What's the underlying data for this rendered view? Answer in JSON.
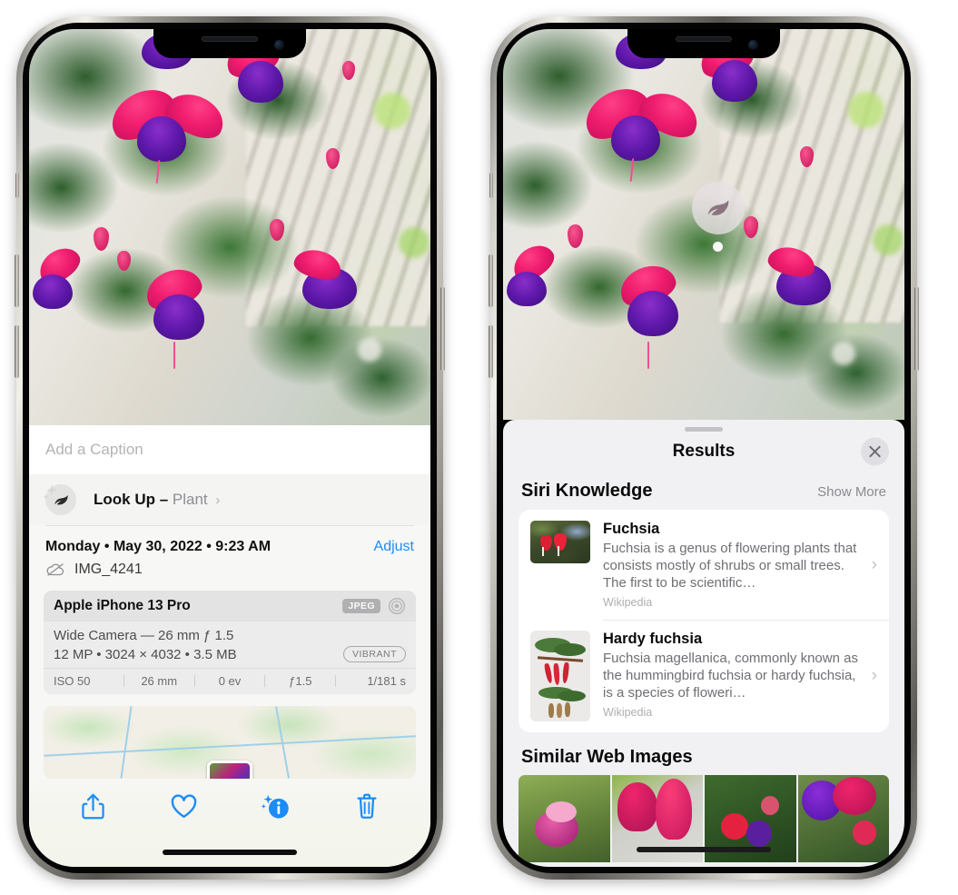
{
  "left_phone": {
    "caption_placeholder": "Add a Caption",
    "lookup": {
      "label": "Look Up –",
      "subject": "Plant",
      "chevron": "›",
      "icon": "leaf-icon"
    },
    "date": "Monday • May 30, 2022 • 9:23 AM",
    "adjust_label": "Adjust",
    "file_name": "IMG_4241",
    "cloud_icon": "icloud-slash-icon",
    "exif": {
      "model": "Apple iPhone 13 Pro",
      "format_badge": "JPEG",
      "aperture_icon": "aperture-icon",
      "lens_line": "Wide Camera — 26 mm ƒ 1.5",
      "size_line": "12 MP • 3024 × 4032 • 3.5 MB",
      "style_badge": "VIBRANT",
      "stats": [
        "ISO 50",
        "26 mm",
        "0 ev",
        "ƒ1.5",
        "1/181 s"
      ]
    },
    "toolbar": [
      {
        "name": "share-button",
        "icon": "share-icon"
      },
      {
        "name": "favorite-button",
        "icon": "heart-icon"
      },
      {
        "name": "info-button",
        "icon": "info-sparkle-icon"
      },
      {
        "name": "delete-button",
        "icon": "trash-icon"
      }
    ],
    "accent_color": "#1c8cf8"
  },
  "right_phone": {
    "badge_icon": "leaf-icon",
    "sheet": {
      "title": "Results",
      "close_icon": "close-icon",
      "grabber": "drag-handle"
    },
    "siri_knowledge": {
      "title": "Siri Knowledge",
      "show_more": "Show More",
      "items": [
        {
          "title": "Fuchsia",
          "description": "Fuchsia is a genus of flowering plants that consists mostly of shrubs or small trees. The first to be scientific…",
          "source": "Wikipedia",
          "chevron": "›"
        },
        {
          "title": "Hardy fuchsia",
          "description": "Fuchsia magellanica, commonly known as the hummingbird fuchsia or hardy fuchsia, is a species of floweri…",
          "source": "Wikipedia",
          "chevron": "›"
        }
      ]
    },
    "similar_web_images": {
      "title": "Similar Web Images",
      "count": 4
    }
  }
}
